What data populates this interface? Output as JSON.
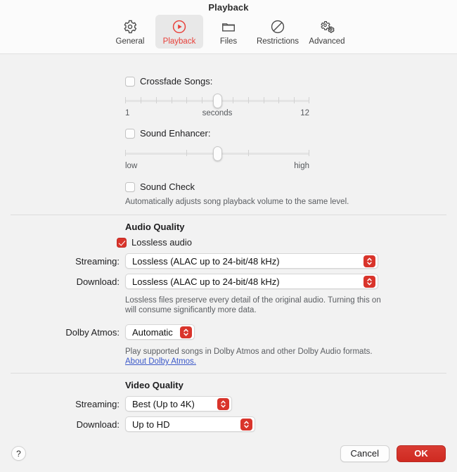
{
  "window": {
    "title": "Playback"
  },
  "toolbar": {
    "tabs": [
      {
        "label": "General",
        "icon": "gear-icon",
        "selected": false
      },
      {
        "label": "Playback",
        "icon": "play-circle-icon",
        "selected": true
      },
      {
        "label": "Files",
        "icon": "folder-icon",
        "selected": false
      },
      {
        "label": "Restrictions",
        "icon": "no-entry-icon",
        "selected": false
      },
      {
        "label": "Advanced",
        "icon": "double-gear-icon",
        "selected": false
      }
    ]
  },
  "crossfade": {
    "label": "Crossfade Songs:",
    "checked": false,
    "slider": {
      "min_label": "1",
      "center_label": "seconds",
      "max_label": "12",
      "value_percent": 50,
      "ticks": 13
    }
  },
  "sound_enhancer": {
    "label": "Sound Enhancer:",
    "checked": false,
    "slider": {
      "min_label": "low",
      "max_label": "high",
      "value_percent": 50,
      "ticks": 4
    }
  },
  "sound_check": {
    "label": "Sound Check",
    "checked": false,
    "description": "Automatically adjusts song playback volume to the same level."
  },
  "audio_quality": {
    "heading": "Audio Quality",
    "lossless": {
      "label": "Lossless audio",
      "checked": true
    },
    "streaming": {
      "label": "Streaming:",
      "value": "Lossless (ALAC up to 24-bit/48 kHz)"
    },
    "download": {
      "label": "Download:",
      "value": "Lossless (ALAC up to 24-bit/48 kHz)"
    },
    "description": "Lossless files preserve every detail of the original audio. Turning this on will consume significantly more data.",
    "dolby": {
      "label": "Dolby Atmos:",
      "value": "Automatic",
      "description": "Play supported songs in Dolby Atmos and other Dolby Audio formats.",
      "link": "About Dolby Atmos."
    }
  },
  "video_quality": {
    "heading": "Video Quality",
    "streaming": {
      "label": "Streaming:",
      "value": "Best (Up to 4K)"
    },
    "download": {
      "label": "Download:",
      "value": "Up to HD"
    }
  },
  "footer": {
    "help": "?",
    "cancel": "Cancel",
    "ok": "OK"
  },
  "colors": {
    "accent_red": "#d9342b",
    "link_blue": "#3c59c9",
    "toolbar_bg": "#fbfbfb",
    "content_bg": "#f2f2f2"
  }
}
